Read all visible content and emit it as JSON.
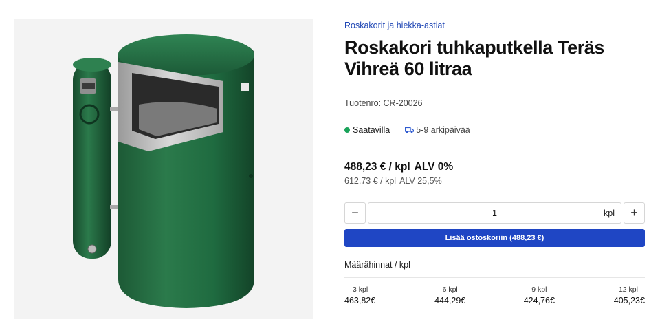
{
  "breadcrumb": "Roskakorit ja hiekka-astiat",
  "product": {
    "title": "Roskakori tuhkaputkella Teräs Vihreä 60 litraa",
    "sku_label": "Tuotenro:",
    "sku_value": "CR-20026",
    "image_icon": "product-photo-green-waste-bin"
  },
  "availability": {
    "status": "Saatavilla",
    "delivery": "5-9 arkipäivää",
    "status_color": "#1aa35a"
  },
  "price": {
    "net": "488,23 € / kpl",
    "net_vat": "ALV 0%",
    "gross": "612,73 € / kpl",
    "gross_vat": "ALV 25,5%"
  },
  "quantity": {
    "value": "1",
    "unit": "kpl",
    "decrement_label": "−",
    "increment_label": "+"
  },
  "cart": {
    "add_label": "Lisää ostoskoriin (488,23 €)",
    "color": "#1f46c4"
  },
  "tiers": {
    "heading": "Määrähinnat / kpl",
    "items": [
      {
        "qty": "3 kpl",
        "price": "463,82€"
      },
      {
        "qty": "6 kpl",
        "price": "444,29€"
      },
      {
        "qty": "9 kpl",
        "price": "424,76€"
      },
      {
        "qty": "12 kpl",
        "price": "405,23€"
      }
    ]
  },
  "colors": {
    "accent": "#1f46b4",
    "product_green": "#1f5a3a"
  }
}
